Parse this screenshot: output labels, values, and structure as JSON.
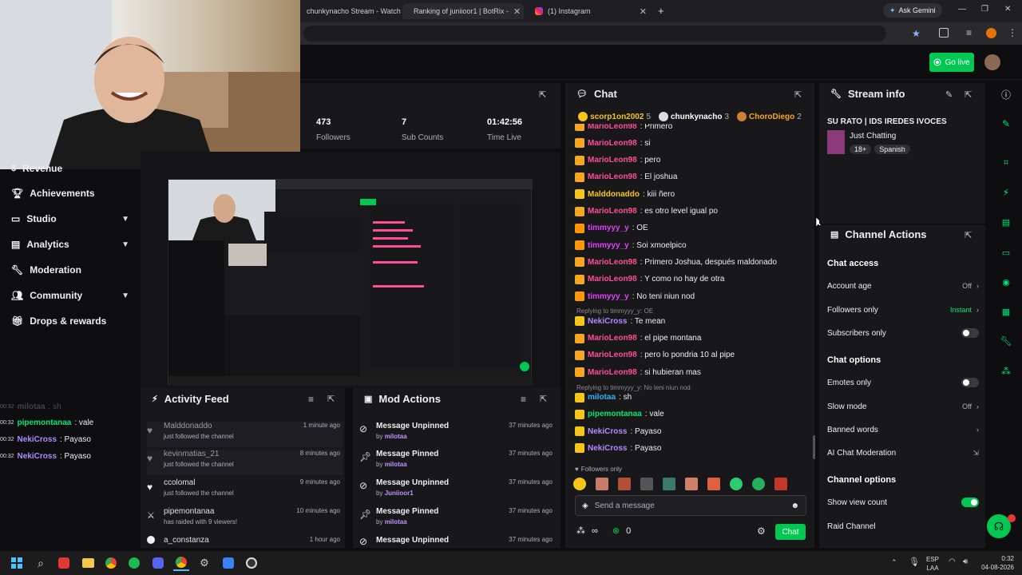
{
  "browser": {
    "tabs": [
      {
        "label": "chunkynacho Stream - Watch L"
      },
      {
        "label": "Ranking of juniioor1 | BotRix -"
      },
      {
        "label": "(1) Instagram"
      }
    ],
    "ask_gemini": "Ask Gemini"
  },
  "header": {
    "go_live": "Go live"
  },
  "sidebar": {
    "items": [
      {
        "label": "Revenue",
        "chev": false
      },
      {
        "label": "Achievements",
        "chev": false
      },
      {
        "label": "Studio",
        "chev": true
      },
      {
        "label": "Analytics",
        "chev": true
      },
      {
        "label": "Moderation",
        "chev": false
      },
      {
        "label": "Community",
        "chev": true
      },
      {
        "label": "Drops & rewards",
        "chev": false
      }
    ],
    "overlay_chat": [
      {
        "time": "00:32",
        "user": "milotaa",
        "msg": ": sh",
        "color": "#555555"
      },
      {
        "time": "00:32",
        "user": "pipemontanaa",
        "msg": ": vale",
        "color": "#00e676"
      },
      {
        "time": "00:32",
        "user": "NekiCross",
        "msg": ": Payaso",
        "color": "#b388ff"
      },
      {
        "time": "00:32",
        "user": "NekiCross",
        "msg": ": Payaso",
        "color": "#b388ff"
      }
    ]
  },
  "stats": [
    {
      "value": "473",
      "label": "Followers"
    },
    {
      "value": "7",
      "label": "Sub Counts"
    },
    {
      "value": "01:42:56",
      "label": "Time Live"
    }
  ],
  "activity_feed": {
    "title": "Activity Feed",
    "rows": [
      {
        "name": "Malddonaddo",
        "sub": "just followed the channel",
        "time": "1 minute ago",
        "dim": true
      },
      {
        "name": "kevinmatias_21",
        "sub": "just followed the channel",
        "time": "8 minutes ago",
        "dim": true
      },
      {
        "name": "ccolomal",
        "sub": "just followed the channel",
        "time": "9 minutes ago",
        "dim": false
      },
      {
        "name": "pipemontanaa",
        "sub": "has raided with 9 viewers!",
        "time": "10 minutes ago",
        "dim": false
      },
      {
        "name": "a_constanza",
        "sub": "",
        "time": "1 hour ago",
        "dim": false
      }
    ]
  },
  "mod_actions": {
    "title": "Mod Actions",
    "by": "by",
    "rows": [
      {
        "action": "Message Unpinned",
        "by": "milotaa",
        "time": "37 minutes ago"
      },
      {
        "action": "Message Pinned",
        "by": "milotaa",
        "time": "37 minutes ago"
      },
      {
        "action": "Message Unpinned",
        "by": "Juniioor1",
        "time": "37 minutes ago"
      },
      {
        "action": "Message Pinned",
        "by": "milotaa",
        "time": "37 minutes ago"
      },
      {
        "action": "Message Unpinned",
        "by": "",
        "time": "37 minutes ago"
      }
    ]
  },
  "chat": {
    "title": "Chat",
    "top_chatters": [
      {
        "name": "scorp1on2002",
        "count": "5",
        "color": "#f5c518"
      },
      {
        "name": "chunkynacho",
        "count": "3",
        "color": "#ffffff"
      },
      {
        "name": "ChoroDiego",
        "count": "2",
        "color": "#f5a623"
      }
    ],
    "lines": [
      {
        "user": "MarioLeon98",
        "msg": ": Primero",
        "color": "#ff4d9a"
      },
      {
        "user": "MarioLeon98",
        "msg": ": si",
        "color": "#ff4d9a"
      },
      {
        "user": "MarioLeon98",
        "msg": ": pero",
        "color": "#ff4d9a"
      },
      {
        "user": "MarioLeon98",
        "msg": ": El joshua",
        "color": "#ff4d9a"
      },
      {
        "user": "Malddonaddo",
        "msg": ": kiii ñero",
        "color": "#f5c518"
      },
      {
        "user": "MarioLeon98",
        "msg": ": es otro level igual po",
        "color": "#ff4d9a"
      },
      {
        "user": "timmyyy_y",
        "msg": ": OE",
        "color": "#e040fb"
      },
      {
        "user": "timmyyy_y",
        "msg": ": Soi xmoelpico",
        "color": "#e040fb"
      },
      {
        "user": "MarioLeon98",
        "msg": ": Primero Joshua, después maldonado",
        "color": "#ff4d9a"
      },
      {
        "user": "MarioLeon98",
        "msg": ": Y como no hay de otra",
        "color": "#ff4d9a"
      },
      {
        "user": "timmyyy_y",
        "msg": ": No teni niun nod",
        "color": "#e040fb"
      },
      {
        "user": "NekiCross",
        "msg": ": Te mean",
        "color": "#b388ff",
        "reply": "Replying to timmyyy_y: OE"
      },
      {
        "user": "MarioLeon98",
        "msg": ": el pipe montana",
        "color": "#ff4d9a"
      },
      {
        "user": "MarioLeon98",
        "msg": ": pero lo pondria 10 al pipe",
        "color": "#ff4d9a"
      },
      {
        "user": "MarioLeon98",
        "msg": ": si hubieran mas",
        "color": "#ff4d9a"
      },
      {
        "user": "milotaa",
        "msg": ": sh",
        "color": "#29b6f6",
        "reply": "Replying to timmyyy_y: No teni niun nod"
      },
      {
        "user": "pipemontanaa",
        "msg": ": vale",
        "color": "#00e676"
      },
      {
        "user": "NekiCross",
        "msg": ": Payaso",
        "color": "#b388ff"
      },
      {
        "user": "NekiCross",
        "msg": ": Payaso",
        "color": "#b388ff"
      }
    ],
    "followers_only": "Followers only",
    "placeholder": "Send a message",
    "viewer_count": "∞",
    "points": "0",
    "send": "Chat"
  },
  "stream_info": {
    "title": "Stream info",
    "stream_title": "SU RATO | IDS IREDES IVOCES",
    "category": "Just Chatting",
    "tags": [
      "18+",
      "Spanish"
    ]
  },
  "channel_actions": {
    "title": "Channel Actions",
    "chat_access": "Chat access",
    "account_age": {
      "label": "Account age",
      "value": "Off"
    },
    "followers_only": {
      "label": "Followers only",
      "value": "Instant"
    },
    "subscribers_only": {
      "label": "Subscribers only",
      "on": false
    },
    "chat_options": "Chat options",
    "emotes_only": {
      "label": "Emotes only",
      "on": false
    },
    "slow_mode": {
      "label": "Slow mode",
      "value": "Off"
    },
    "banned_words": {
      "label": "Banned words"
    },
    "ai_moderation": {
      "label": "AI Chat Moderation"
    },
    "channel_options": "Channel options",
    "show_view_count": {
      "label": "Show view count",
      "on": true
    },
    "raid_channel": {
      "label": "Raid Channel"
    }
  },
  "taskbar": {
    "lang_top": "ESP",
    "lang_bottom": "LAA",
    "time": "0:32",
    "date": "04-08-2026"
  },
  "colors": {
    "accent": "#00c853",
    "panel": "#18181b",
    "bg": "#0e0e10"
  }
}
